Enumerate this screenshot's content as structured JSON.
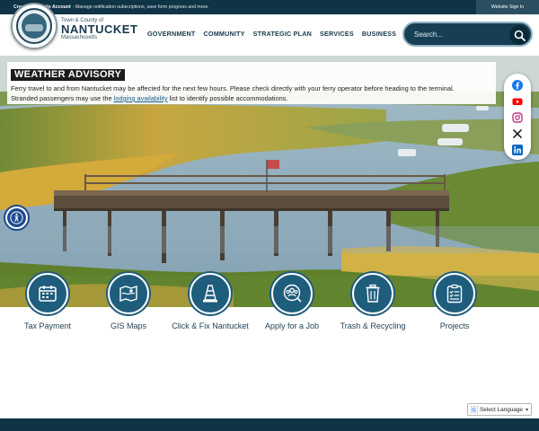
{
  "topbar": {
    "create_account": "Create a Website Account",
    "create_account_desc": "- Manage notification subscriptions, save form progress and more.",
    "sign_in": "Website Sign In"
  },
  "header": {
    "brand_pre": "Town & County of",
    "brand_name": "NANTUCKET",
    "brand_state": "Massachusetts",
    "seal_text": "TOWN AND COUNTY OF NANTUCKET INCORPORATED 1671"
  },
  "nav": {
    "items": [
      {
        "label": "GOVERNMENT"
      },
      {
        "label": "COMMUNITY"
      },
      {
        "label": "STRATEGIC PLAN"
      },
      {
        "label": "SERVICES"
      },
      {
        "label": "BUSINESS"
      }
    ]
  },
  "search": {
    "placeholder": "Search..."
  },
  "advisory": {
    "title": "WEATHER ADVISORY",
    "line1": "Ferry travel to and from Nantucket may be affected for the next few hours. Please check directly with your ferry operator before heading to the terminal.",
    "line2_pre": "Stranded passengers may use the ",
    "link": "lodging availability",
    "line2_post": " list to identify possible accommodations."
  },
  "social": {
    "items": [
      {
        "icon": "facebook-icon",
        "color": "#1877f2"
      },
      {
        "icon": "youtube-icon",
        "color": "#ff0000"
      },
      {
        "icon": "instagram-icon",
        "color": "#c13584"
      },
      {
        "icon": "x-icon",
        "color": "#000000"
      },
      {
        "icon": "linkedin-icon",
        "color": "#0a66c2"
      }
    ]
  },
  "quick_links": {
    "items": [
      {
        "label": "Tax Payment",
        "icon": "calendar-payment-icon"
      },
      {
        "label": "GIS Maps",
        "icon": "map-icon"
      },
      {
        "label": "Click & Fix Nantucket",
        "icon": "traffic-cone-icon"
      },
      {
        "label": "Apply for a Job",
        "icon": "people-search-icon"
      },
      {
        "label": "Trash & Recycling",
        "icon": "trash-icon"
      },
      {
        "label": "Projects",
        "icon": "clipboard-icon"
      }
    ]
  },
  "translate": {
    "label": "Select Language"
  },
  "colors": {
    "brand_dark": "#0f3446",
    "accent": "#1f5d7c",
    "advisory_title_bg": "#1b1b1b"
  }
}
